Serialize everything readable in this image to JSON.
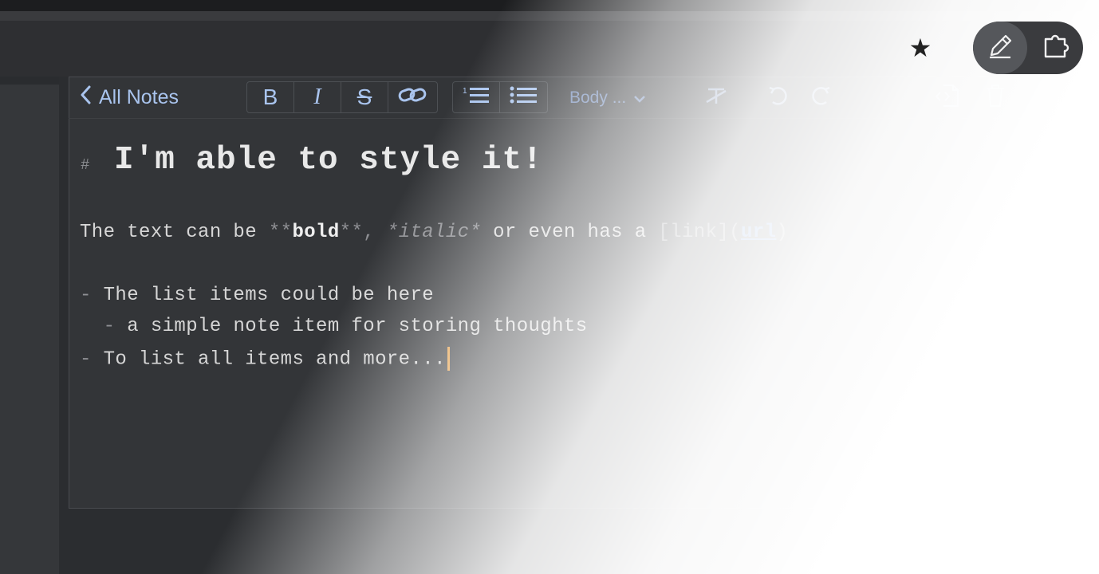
{
  "window": {
    "accent": "#a9c4ee",
    "caret_color": "#e59a3b"
  },
  "header": {
    "star_icon": "star-icon",
    "mode_toggle": {
      "edit_icon": "pencil-icon",
      "plugin_icon": "puzzle-icon"
    }
  },
  "toolbar": {
    "back_label": "All Notes",
    "bold_label": "B",
    "italic_label": "I",
    "strike_label": "S",
    "style_select_value": "Body ...",
    "icons": [
      "link-icon",
      "ordered-list-icon",
      "bullet-list-icon",
      "clear-format-icon",
      "undo-icon",
      "redo-icon",
      "source-icon",
      "trash-icon"
    ]
  },
  "editor": {
    "heading_marker": "#",
    "heading_text": "I'm able to style it!",
    "para": {
      "t1": "The text can be ",
      "bold_open": "**",
      "bold_text": "bold",
      "bold_close": "**",
      "sep": ", ",
      "italic_text": "*italic*",
      "t2": " or even has a ",
      "link_open": "[",
      "link_text": "link",
      "link_mid": "](",
      "url_text": "url",
      "link_close": ")"
    },
    "list": [
      {
        "marker": "- ",
        "text": "The list items could be here",
        "indent": ""
      },
      {
        "marker": "- ",
        "text": "a simple note item for storing thoughts",
        "indent": "  "
      },
      {
        "marker": "- ",
        "text": "To list all items and more...",
        "indent": ""
      }
    ]
  }
}
